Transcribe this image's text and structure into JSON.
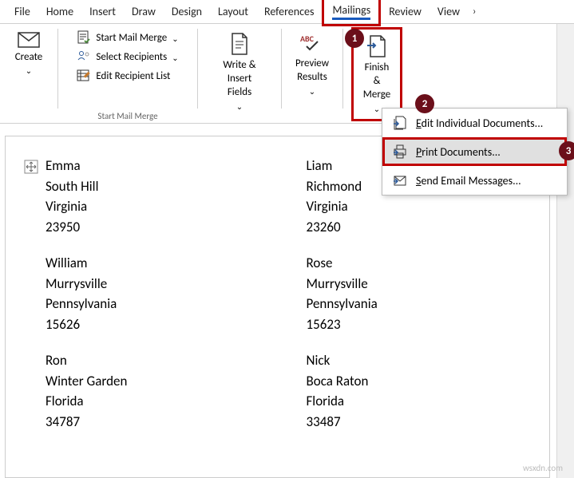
{
  "tabs": {
    "file": "File",
    "home": "Home",
    "insert": "Insert",
    "draw": "Draw",
    "design": "Design",
    "layout": "Layout",
    "references": "References",
    "mailings": "Mailings",
    "review": "Review",
    "view": "View",
    "overflow": "›"
  },
  "ribbon": {
    "create": {
      "label": "Create"
    },
    "startMailMerge": {
      "smm": "Start Mail Merge",
      "select": "Select Recipients",
      "edit": "Edit Recipient List",
      "groupLabel": "Start Mail Merge"
    },
    "writeInsert": {
      "label": "Write & Insert\nFields"
    },
    "preview": {
      "label": "Preview\nResults"
    },
    "finish": {
      "label": "Finish &\nMerge"
    }
  },
  "menu": {
    "editIndividual": "dit Individual Documents...",
    "editIndividualAccel": "E",
    "print": "rint Documents...",
    "printAccel": "P",
    "send": "end Email Messages...",
    "sendAccel": "S"
  },
  "callouts": {
    "one": "1",
    "two": "2",
    "three": "3"
  },
  "records": {
    "left": [
      {
        "name": "Emma",
        "city": "South Hill",
        "state": "Virginia",
        "zip": "23950"
      },
      {
        "name": "William",
        "city": "Murrysville",
        "state": "Pennsylvania",
        "zip": "15626"
      },
      {
        "name": "Ron",
        "city": "Winter Garden",
        "state": "Florida",
        "zip": "34787"
      }
    ],
    "right": [
      {
        "name": "Liam",
        "city": "Richmond",
        "state": "Virginia",
        "zip": "23260"
      },
      {
        "name": "Rose",
        "city": "Murrysville",
        "state": "Pennsylvania",
        "zip": "15623"
      },
      {
        "name": "Nick",
        "city": "Boca Raton",
        "state": "Florida",
        "zip": "33487"
      }
    ]
  },
  "watermark": "wsxdn.com"
}
